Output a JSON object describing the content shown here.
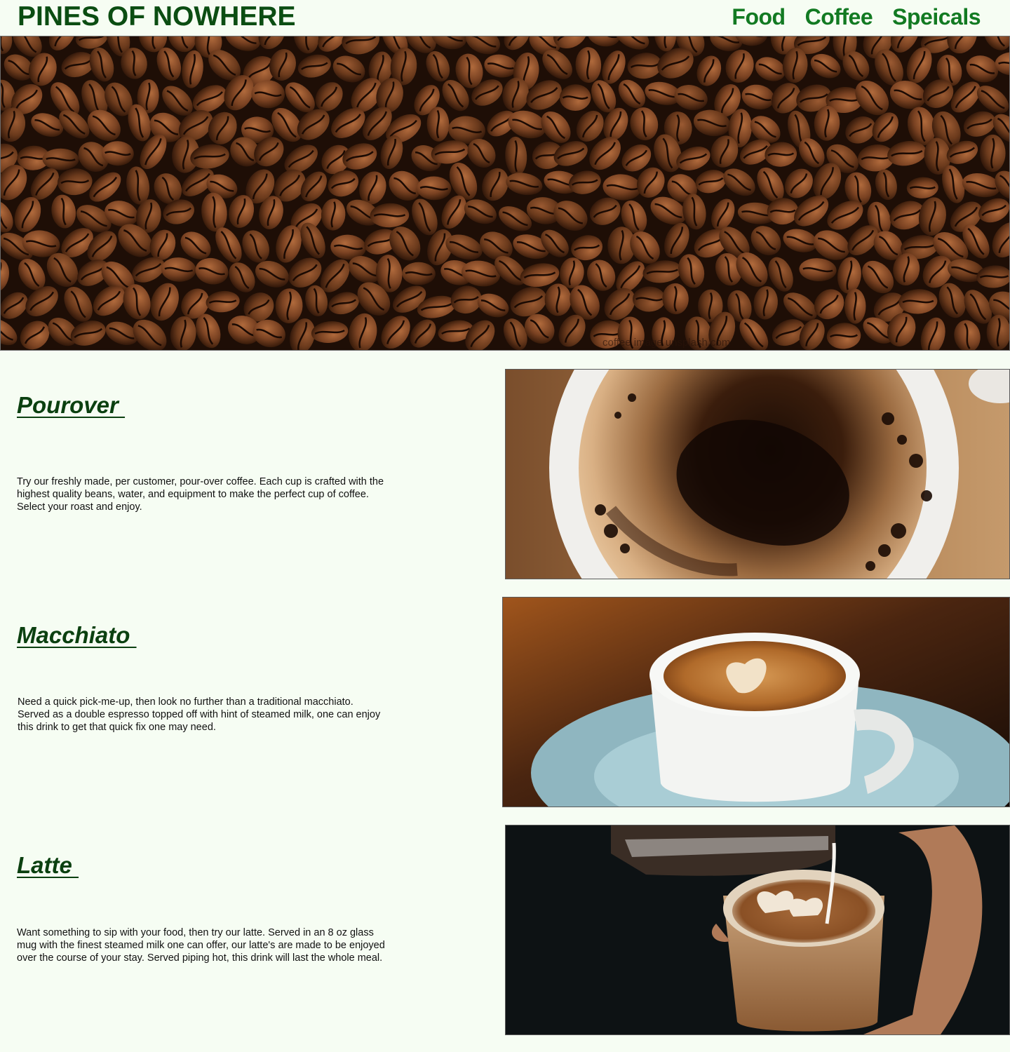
{
  "header": {
    "logo": "PINES OF NOWHERE",
    "nav": [
      "Food",
      "Coffee",
      "Speicals"
    ]
  },
  "hero": {
    "caption": "coffee image unsplash.com"
  },
  "sections": [
    {
      "title": "Pourover ",
      "text": "Try our freshly made, per customer, pour-over coffee. Each cup is crafted with the highest quality beans, water, and equipment to make the perfect cup of coffee. Select your roast and enjoy."
    },
    {
      "title": "Macchiato ",
      "text": "Need a quick pick-me-up, then look no further than a traditional macchiato. Served as a double espresso topped off with hint of steamed milk, one can enjoy this drink to get that quick fix one may need."
    },
    {
      "title": "Latte ",
      "text": "Want something to sip with your food, then try our latte. Served in an 8 oz glass mug with the finest steamed milk one can offer, our latte's are made to be enjoyed over the course of your stay. Served piping hot, this drink will last the whole meal."
    }
  ],
  "colors": {
    "background": "#f6fdf3",
    "logo": "#0b4d12",
    "nav": "#127a22",
    "heading": "#0b4010"
  }
}
